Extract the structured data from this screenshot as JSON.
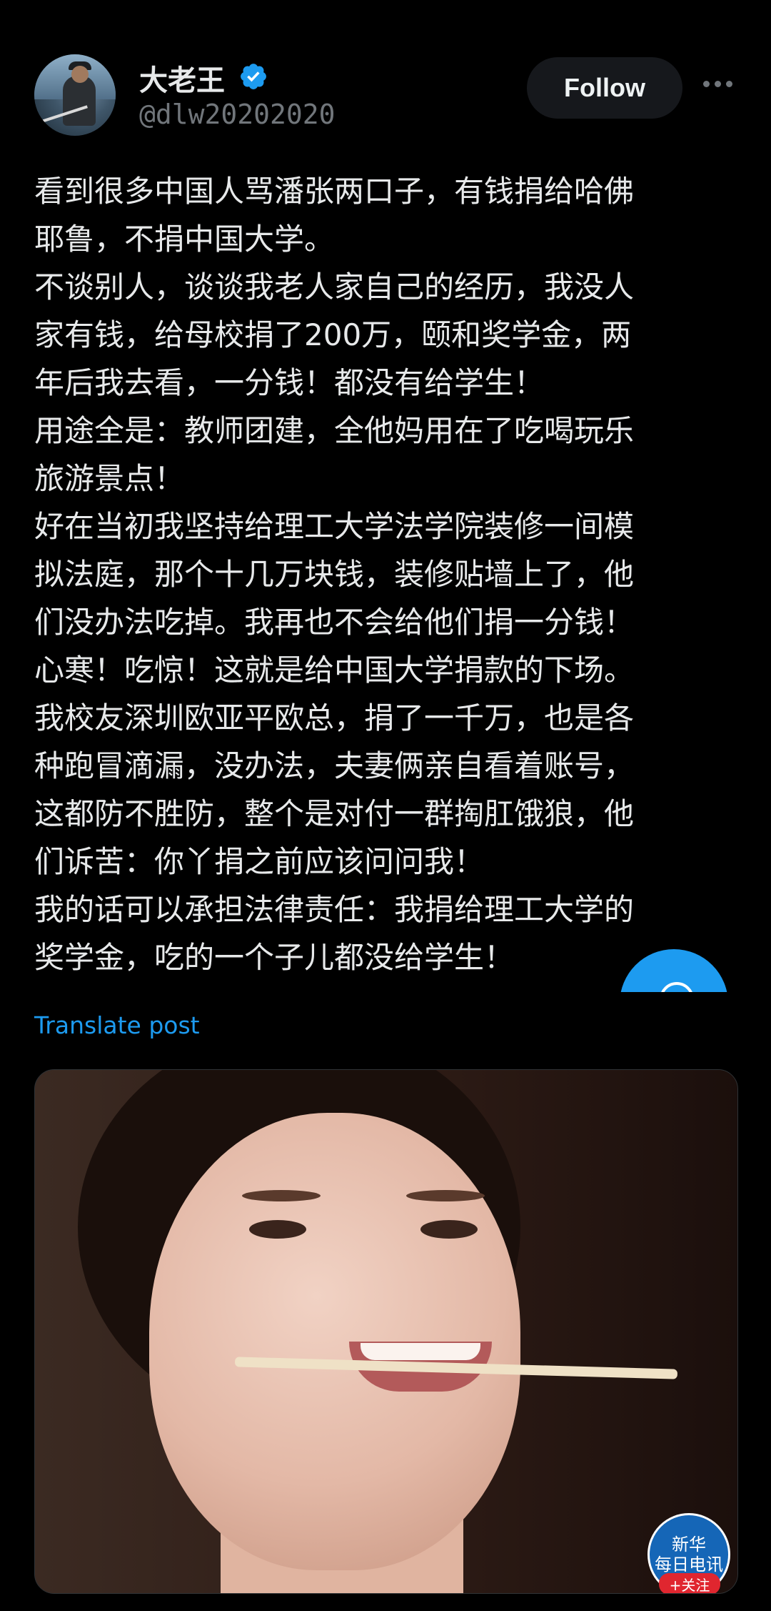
{
  "author": {
    "display_name": "大老王",
    "handle": "@dlw20202020",
    "verified": true,
    "verified_icon": "verified-badge-icon"
  },
  "actions": {
    "follow_label": "Follow",
    "more_icon": "more-options-icon"
  },
  "post": {
    "lines": [
      "看到很多中国人骂潘张两口子，有钱捐给哈佛",
      "耶鲁，不捐中国大学。",
      "不谈别人，谈谈我老人家自己的经历，我没人",
      "家有钱，给母校捐了200万，颐和奖学金，两",
      "年后我去看，一分钱！都没有给学生！",
      "用途全是：教师团建，全他妈用在了吃喝玩乐",
      "旅游景点！",
      "好在当初我坚持给理工大学法学院装修一间模",
      "拟法庭，那个十几万块钱，装修贴墙上了，他",
      "们没办法吃掉。我再也不会给他们捐一分钱！",
      "心寒！吃惊！这就是给中国大学捐款的下场。",
      "我校友深圳欧亚平欧总，捐了一千万，也是各",
      "种跑冒滴漏，没办法，夫妻俩亲自看着账号，",
      "这都防不胜防，整个是对付一群掏肛饿狼，他",
      "们诉苦：你丫捐之前应该问问我！",
      "我的话可以承担法律责任：我捐给理工大学的",
      "奖学金，吃的一个子儿都没给学生！"
    ],
    "translate_label": "Translate post"
  },
  "media": {
    "watermark_line1": "新华",
    "watermark_line2": "每日电讯",
    "watermark_follow": "+关注"
  },
  "colors": {
    "background": "#000000",
    "text": "#e7e9ea",
    "muted": "#71767b",
    "accent": "#1d9bf0"
  }
}
